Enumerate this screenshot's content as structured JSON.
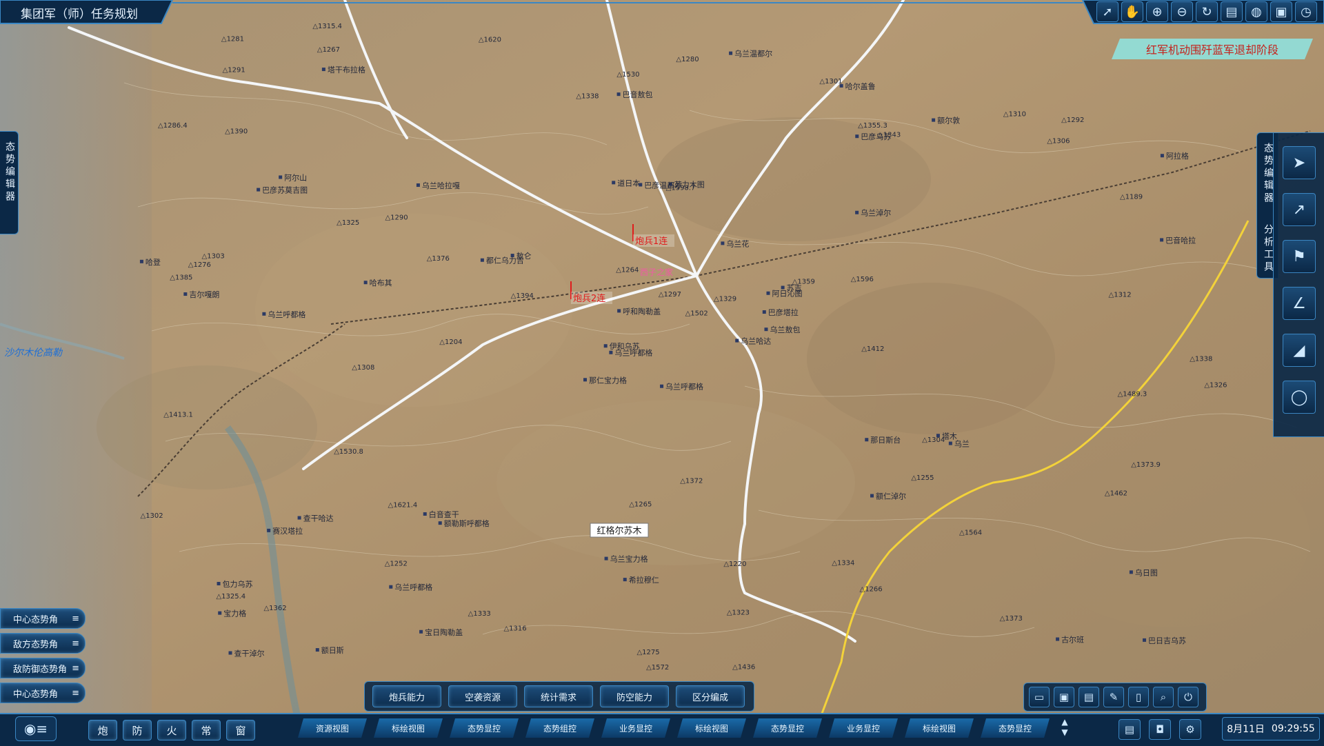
{
  "app": {
    "title": "集团军（师）任务规划"
  },
  "phase_banner": "红军机动围歼蓝军退却阶段",
  "side_panels": {
    "left": "态势编辑器",
    "right_top": "态势编辑器",
    "right_bottom": "分析工具"
  },
  "toolbar_top": [
    "select-icon",
    "hand-icon",
    "zoom-in-icon",
    "zoom-out-icon",
    "refresh-icon",
    "layers-icon",
    "globe-icon",
    "window-icon",
    "clock-icon"
  ],
  "right_tools": [
    "arrow-tool-icon",
    "line-tool-icon",
    "marker-tool-icon",
    "angle-tool-icon",
    "area-tool-icon",
    "circle-tool-icon"
  ],
  "left_views": [
    "中心态势角",
    "敌方态势角",
    "敌防御态势角",
    "中心态势角"
  ],
  "center_buttons": [
    "炮兵能力",
    "空袭资源",
    "统计需求",
    "防空能力",
    "区分编成"
  ],
  "bottom_tabs": [
    "资源视图",
    "标绘视图",
    "态势显控",
    "态势组控",
    "业务显控",
    "标绘视图",
    "态势显控",
    "业务显控",
    "标绘视图",
    "态势显控"
  ],
  "bottom_left_buttons": [
    "炮",
    "防",
    "火",
    "常",
    "窗"
  ],
  "bottom_right_icons": [
    "folder-icon",
    "save-icon",
    "save-as-icon",
    "edit-icon",
    "document-icon",
    "search-doc-icon",
    "power-icon"
  ],
  "status_icons": [
    "file-icon",
    "chat-icon",
    "settings-icon"
  ],
  "datetime": {
    "date": "8月11日",
    "time": "09:29:55"
  },
  "map": {
    "center_label": "红格尔苏木",
    "unit_markers": [
      "炮兵1连",
      "炮兵2连"
    ],
    "annotation": "西子之家",
    "water_label": "沙尔木伦高勒",
    "place_names": [
      "乌兰呼都格",
      "巴彦苏莫吉图",
      "乌兰呼都格",
      "包力乌苏",
      "阿日沁图",
      "额勒斯呼都格",
      "哈尔盖鲁",
      "苏力木图",
      "巴彦乌苏",
      "乌兰哈达",
      "塔干布拉格",
      "巴日吉乌苏",
      "乌兰呼都格",
      "阿拉格",
      "那仁宝力格",
      "乌兰淖尔",
      "额日斯",
      "道日本",
      "乌兰花",
      "查干哈达",
      "敖仑",
      "宝力格",
      "乌兰呼都格",
      "巴彦温都尔",
      "苏吉",
      "乌兰",
      "阿尔山",
      "巴音敖包",
      "吉尔嘎朗",
      "那日斯台",
      "巴音哈拉",
      "伊和乌苏",
      "乌兰宝力格",
      "呼和陶勒盖",
      "乌兰哈拉嘎",
      "额尔敦",
      "白音查干",
      "古尔班",
      "乌日图",
      "塔木",
      "乌兰温都尔",
      "都仁乌力吉",
      "哈布其",
      "额仁淖尔",
      "宝日陶勒盖",
      "哈登",
      "巴彦塔拉",
      "查干淖尔",
      "希拉穆仁",
      "乌兰敖包",
      "赛汉塔拉"
    ],
    "spot_heights": [
      "1189",
      "1286.4",
      "1255",
      "1266",
      "1252",
      "1267",
      "1281",
      "1220",
      "1292",
      "1280",
      "1204",
      "1303",
      "1290",
      "1310",
      "1315.4",
      "1301",
      "1338",
      "1297",
      "1302",
      "1265",
      "1316",
      "1304",
      "1376",
      "1325.4",
      "1291",
      "1325",
      "1413.1",
      "1264",
      "1323",
      "1329",
      "1362",
      "1412",
      "1373.9",
      "1275",
      "1312",
      "1372",
      "1373",
      "1436",
      "1334",
      "1530",
      "1326",
      "1596",
      "1564",
      "1502",
      "1462",
      "1276",
      "1572",
      "1355.3",
      "1343",
      "1308",
      "1620",
      "1338",
      "1385",
      "1530.8",
      "1621.4",
      "1333",
      "1359",
      "1306",
      "1394",
      "1489.3",
      "1390",
      "1598.7"
    ]
  }
}
